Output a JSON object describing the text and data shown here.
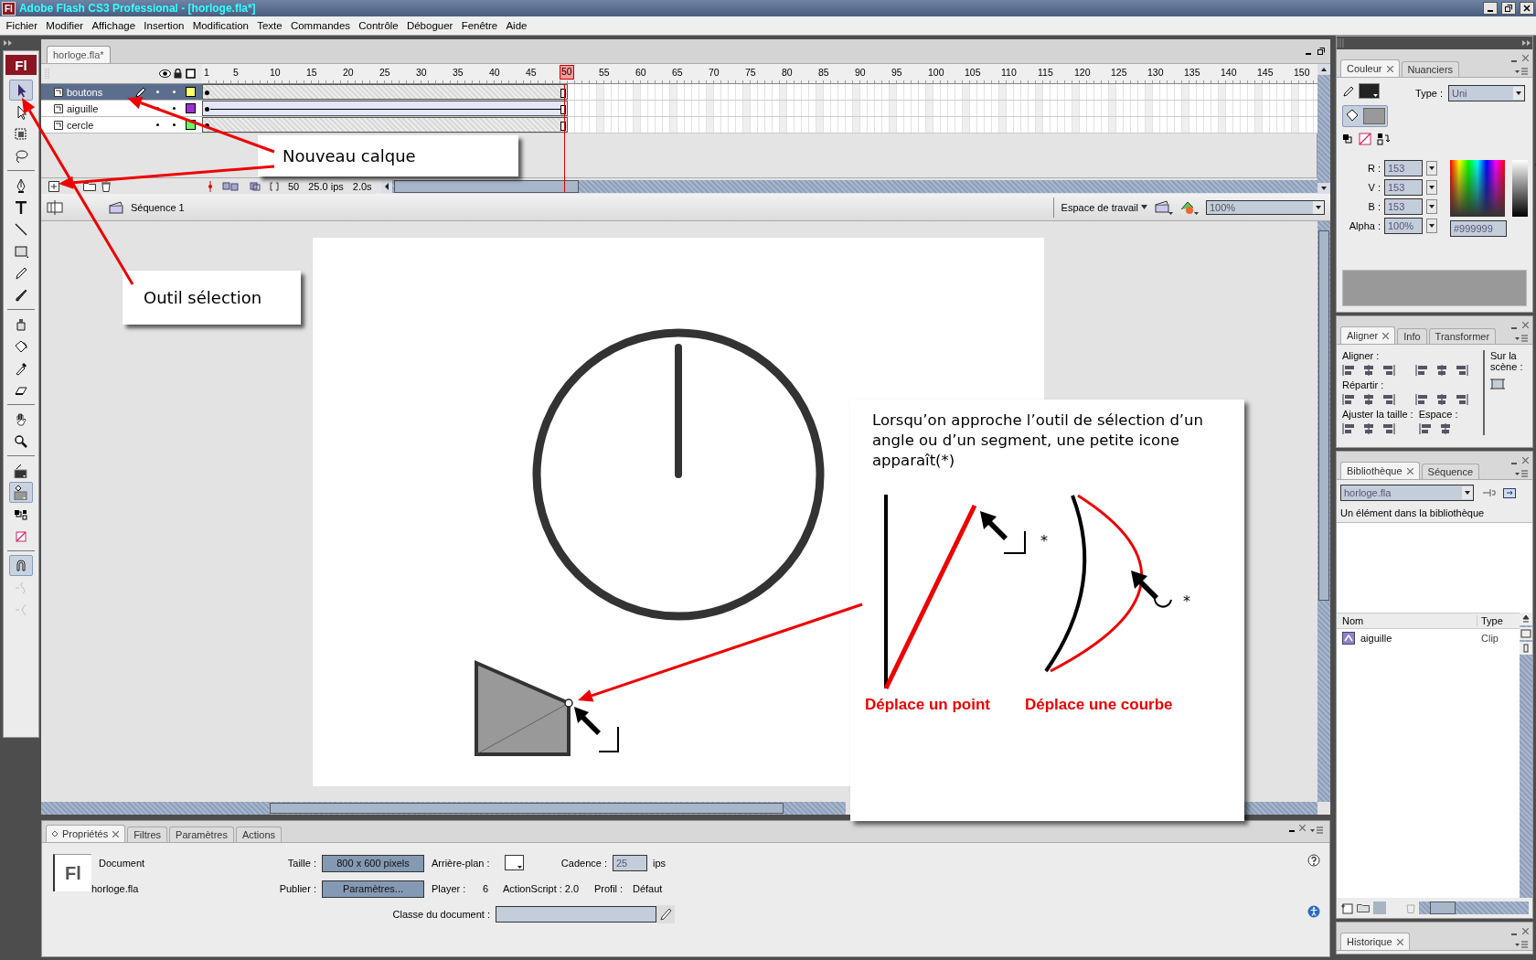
{
  "window": {
    "app_icon": "Fl",
    "title": "Adobe Flash CS3 Professional - [horloge.fla*]"
  },
  "menu": [
    "Fichier",
    "Modifier",
    "Affichage",
    "Insertion",
    "Modification",
    "Texte",
    "Commandes",
    "Contrôle",
    "Déboguer",
    "Fenêtre",
    "Aide"
  ],
  "toolbar": {
    "logo": "Fl",
    "groups": [
      [
        {
          "kind": "selection",
          "selected": true,
          "disabled": false
        },
        {
          "kind": "subselection",
          "selected": false,
          "disabled": false
        },
        {
          "kind": "free-transform",
          "selected": false,
          "disabled": false
        },
        {
          "kind": "lasso",
          "selected": false,
          "disabled": false
        }
      ],
      [
        {
          "kind": "pen",
          "selected": false,
          "disabled": false
        },
        {
          "kind": "text",
          "selected": false,
          "disabled": false
        },
        {
          "kind": "line",
          "selected": false,
          "disabled": false
        },
        {
          "kind": "rectangle",
          "selected": false,
          "disabled": false
        },
        {
          "kind": "pencil",
          "selected": false,
          "disabled": false
        },
        {
          "kind": "brush",
          "selected": false,
          "disabled": false
        }
      ],
      [
        {
          "kind": "ink-bottle",
          "selected": false,
          "disabled": false
        },
        {
          "kind": "paint-bucket",
          "selected": false,
          "disabled": false
        },
        {
          "kind": "eyedropper",
          "selected": false,
          "disabled": false
        },
        {
          "kind": "eraser",
          "selected": false,
          "disabled": false
        }
      ],
      [
        {
          "kind": "hand",
          "selected": false,
          "disabled": false
        },
        {
          "kind": "zoom",
          "selected": false,
          "disabled": false
        }
      ],
      [
        {
          "kind": "stroke-color",
          "selected": false,
          "disabled": false
        },
        {
          "kind": "fill-color",
          "selected": true,
          "disabled": false
        },
        {
          "kind": "color-options",
          "selected": false,
          "disabled": false
        },
        {
          "kind": "no-color",
          "selected": false,
          "disabled": false
        }
      ],
      [
        {
          "kind": "snap",
          "selected": true,
          "disabled": false
        },
        {
          "kind": "smooth",
          "selected": false,
          "disabled": true
        },
        {
          "kind": "straighten",
          "selected": false,
          "disabled": true
        }
      ]
    ]
  },
  "document_tabs": [
    {
      "label": "horloge.fla*",
      "selected": true
    }
  ],
  "timeline": {
    "frames": [
      {
        "label": "1",
        "current": false
      },
      {
        "label": "5",
        "current": false
      },
      {
        "label": "10",
        "current": false
      },
      {
        "label": "15",
        "current": false
      },
      {
        "label": "20",
        "current": false
      },
      {
        "label": "25",
        "current": false
      },
      {
        "label": "30",
        "current": false
      },
      {
        "label": "35",
        "current": false
      },
      {
        "label": "40",
        "current": false
      },
      {
        "label": "45",
        "current": false
      },
      {
        "label": "50",
        "current": true
      },
      {
        "label": "55",
        "current": false
      },
      {
        "label": "60",
        "current": false
      },
      {
        "label": "65",
        "current": false
      },
      {
        "label": "70",
        "current": false
      },
      {
        "label": "75",
        "current": false
      },
      {
        "label": "80",
        "current": false
      },
      {
        "label": "85",
        "current": false
      },
      {
        "label": "90",
        "current": false
      },
      {
        "label": "95",
        "current": false
      },
      {
        "label": "100",
        "current": false
      },
      {
        "label": "105",
        "current": false
      },
      {
        "label": "110",
        "current": false
      },
      {
        "label": "115",
        "current": false
      },
      {
        "label": "120",
        "current": false
      },
      {
        "label": "125",
        "current": false
      },
      {
        "label": "130",
        "current": false
      },
      {
        "label": "135",
        "current": false
      },
      {
        "label": "140",
        "current": false
      },
      {
        "label": "145",
        "current": false
      },
      {
        "label": "150",
        "current": false
      }
    ],
    "layers": [
      {
        "name": "boutons",
        "selected": true,
        "color": "#ffff66",
        "tween": false
      },
      {
        "name": "aiguille",
        "selected": false,
        "color": "#9933cc",
        "tween": true
      },
      {
        "name": "cercle",
        "selected": false,
        "color": "#66ff66",
        "tween": false
      }
    ],
    "footer": {
      "frame": "50",
      "rate": "25.0 ips",
      "time": "2.0s"
    }
  },
  "edit_bar": {
    "scene": "Séquence 1",
    "workspace": "Espace de travail",
    "zoom": "100%"
  },
  "properties": {
    "tabs": [
      {
        "label": "Propriétés",
        "selected": true
      },
      {
        "label": "Filtres",
        "selected": false
      },
      {
        "label": "Paramètres",
        "selected": false
      },
      {
        "label": "Actions",
        "selected": false
      }
    ],
    "doc_icon": "Fl",
    "kind_label": "Document",
    "file_name": "horloge.fla",
    "size_label": "Taille :",
    "size_button": "800 x 600 pixels",
    "background_label": "Arrière-plan :",
    "rate_label": "Cadence :",
    "rate_value": "25",
    "rate_unit": "ips",
    "publish_label": "Publier :",
    "publish_button": "Paramètres...",
    "player_label": "Player :",
    "player_value": "6",
    "actionscript": "ActionScript : 2.0",
    "profile_label": "Profil :",
    "profile_value": "Défaut",
    "class_label": "Classe du document :"
  },
  "color_panel": {
    "tabs": [
      {
        "label": "Couleur",
        "selected": true
      },
      {
        "label": "Nuanciers",
        "selected": false
      }
    ],
    "type_label": "Type :",
    "type_value": "Uni",
    "channels": [
      {
        "label": "R :",
        "value": "153"
      },
      {
        "label": "V :",
        "value": "153"
      },
      {
        "label": "B :",
        "value": "153"
      },
      {
        "label": "Alpha :",
        "value": "100%"
      }
    ],
    "hex": "#999999"
  },
  "align_panel": {
    "tabs": [
      {
        "label": "Aligner",
        "selected": true
      },
      {
        "label": "Info",
        "selected": false
      },
      {
        "label": "Transformer",
        "selected": false
      }
    ],
    "sections": [
      {
        "kind": "align",
        "label": "Aligner :"
      },
      {
        "kind": "distribute",
        "label": "Répartir :"
      },
      {
        "kind": "match",
        "label": "Ajuster la taille :"
      },
      {
        "kind": "space",
        "label": "Espace :"
      }
    ],
    "stage_label": "Sur la scène :"
  },
  "library_panel": {
    "tabs": [
      {
        "label": "Bibliothèque",
        "selected": true
      },
      {
        "label": "Séquence",
        "selected": false
      }
    ],
    "source": "horloge.fla",
    "summary": "Un élément dans la bibliothèque",
    "columns": [
      "Nom",
      "Type"
    ],
    "items": [
      {
        "name": "aiguille",
        "type": "Clip"
      }
    ]
  },
  "history_panel": {
    "tabs": [
      {
        "label": "Historique",
        "selected": true
      }
    ]
  },
  "annotations": {
    "callouts": [
      "Nouveau calque",
      "Outil sélection"
    ],
    "note": {
      "text": "Lorsqu’on approche l’outil de sélection d’un angle ou d’un segment, une petite icone apparaît(*)",
      "marks": [
        "*",
        "*"
      ],
      "captions": [
        "Déplace un point",
        "Déplace une courbe"
      ]
    }
  }
}
